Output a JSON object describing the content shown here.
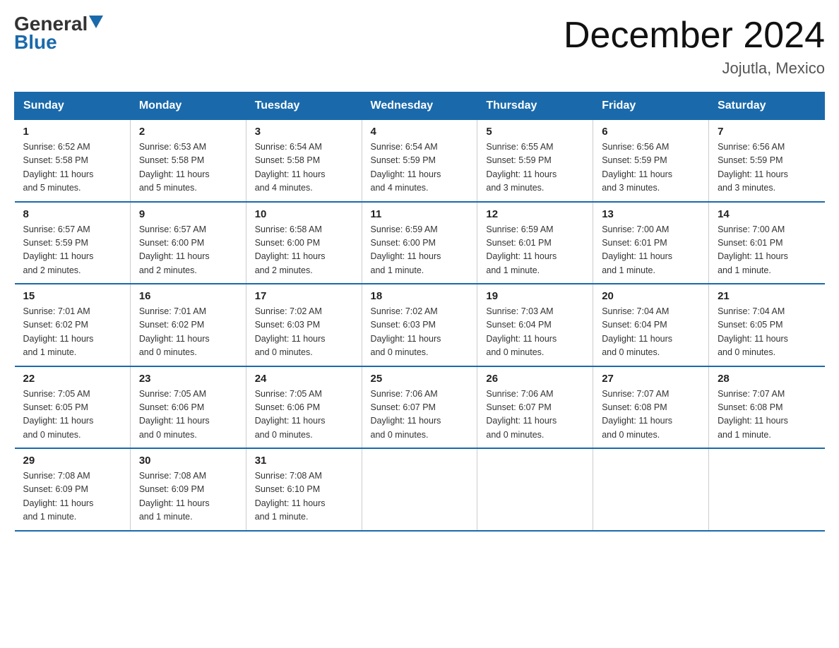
{
  "header": {
    "logo_general": "General",
    "logo_blue": "Blue",
    "title": "December 2024",
    "subtitle": "Jojutla, Mexico"
  },
  "days_of_week": [
    "Sunday",
    "Monday",
    "Tuesday",
    "Wednesday",
    "Thursday",
    "Friday",
    "Saturday"
  ],
  "weeks": [
    [
      {
        "day": "1",
        "sunrise": "6:52 AM",
        "sunset": "5:58 PM",
        "daylight": "11 hours and 5 minutes."
      },
      {
        "day": "2",
        "sunrise": "6:53 AM",
        "sunset": "5:58 PM",
        "daylight": "11 hours and 5 minutes."
      },
      {
        "day": "3",
        "sunrise": "6:54 AM",
        "sunset": "5:58 PM",
        "daylight": "11 hours and 4 minutes."
      },
      {
        "day": "4",
        "sunrise": "6:54 AM",
        "sunset": "5:59 PM",
        "daylight": "11 hours and 4 minutes."
      },
      {
        "day": "5",
        "sunrise": "6:55 AM",
        "sunset": "5:59 PM",
        "daylight": "11 hours and 3 minutes."
      },
      {
        "day": "6",
        "sunrise": "6:56 AM",
        "sunset": "5:59 PM",
        "daylight": "11 hours and 3 minutes."
      },
      {
        "day": "7",
        "sunrise": "6:56 AM",
        "sunset": "5:59 PM",
        "daylight": "11 hours and 3 minutes."
      }
    ],
    [
      {
        "day": "8",
        "sunrise": "6:57 AM",
        "sunset": "5:59 PM",
        "daylight": "11 hours and 2 minutes."
      },
      {
        "day": "9",
        "sunrise": "6:57 AM",
        "sunset": "6:00 PM",
        "daylight": "11 hours and 2 minutes."
      },
      {
        "day": "10",
        "sunrise": "6:58 AM",
        "sunset": "6:00 PM",
        "daylight": "11 hours and 2 minutes."
      },
      {
        "day": "11",
        "sunrise": "6:59 AM",
        "sunset": "6:00 PM",
        "daylight": "11 hours and 1 minute."
      },
      {
        "day": "12",
        "sunrise": "6:59 AM",
        "sunset": "6:01 PM",
        "daylight": "11 hours and 1 minute."
      },
      {
        "day": "13",
        "sunrise": "7:00 AM",
        "sunset": "6:01 PM",
        "daylight": "11 hours and 1 minute."
      },
      {
        "day": "14",
        "sunrise": "7:00 AM",
        "sunset": "6:01 PM",
        "daylight": "11 hours and 1 minute."
      }
    ],
    [
      {
        "day": "15",
        "sunrise": "7:01 AM",
        "sunset": "6:02 PM",
        "daylight": "11 hours and 1 minute."
      },
      {
        "day": "16",
        "sunrise": "7:01 AM",
        "sunset": "6:02 PM",
        "daylight": "11 hours and 0 minutes."
      },
      {
        "day": "17",
        "sunrise": "7:02 AM",
        "sunset": "6:03 PM",
        "daylight": "11 hours and 0 minutes."
      },
      {
        "day": "18",
        "sunrise": "7:02 AM",
        "sunset": "6:03 PM",
        "daylight": "11 hours and 0 minutes."
      },
      {
        "day": "19",
        "sunrise": "7:03 AM",
        "sunset": "6:04 PM",
        "daylight": "11 hours and 0 minutes."
      },
      {
        "day": "20",
        "sunrise": "7:04 AM",
        "sunset": "6:04 PM",
        "daylight": "11 hours and 0 minutes."
      },
      {
        "day": "21",
        "sunrise": "7:04 AM",
        "sunset": "6:05 PM",
        "daylight": "11 hours and 0 minutes."
      }
    ],
    [
      {
        "day": "22",
        "sunrise": "7:05 AM",
        "sunset": "6:05 PM",
        "daylight": "11 hours and 0 minutes."
      },
      {
        "day": "23",
        "sunrise": "7:05 AM",
        "sunset": "6:06 PM",
        "daylight": "11 hours and 0 minutes."
      },
      {
        "day": "24",
        "sunrise": "7:05 AM",
        "sunset": "6:06 PM",
        "daylight": "11 hours and 0 minutes."
      },
      {
        "day": "25",
        "sunrise": "7:06 AM",
        "sunset": "6:07 PM",
        "daylight": "11 hours and 0 minutes."
      },
      {
        "day": "26",
        "sunrise": "7:06 AM",
        "sunset": "6:07 PM",
        "daylight": "11 hours and 0 minutes."
      },
      {
        "day": "27",
        "sunrise": "7:07 AM",
        "sunset": "6:08 PM",
        "daylight": "11 hours and 0 minutes."
      },
      {
        "day": "28",
        "sunrise": "7:07 AM",
        "sunset": "6:08 PM",
        "daylight": "11 hours and 1 minute."
      }
    ],
    [
      {
        "day": "29",
        "sunrise": "7:08 AM",
        "sunset": "6:09 PM",
        "daylight": "11 hours and 1 minute."
      },
      {
        "day": "30",
        "sunrise": "7:08 AM",
        "sunset": "6:09 PM",
        "daylight": "11 hours and 1 minute."
      },
      {
        "day": "31",
        "sunrise": "7:08 AM",
        "sunset": "6:10 PM",
        "daylight": "11 hours and 1 minute."
      },
      null,
      null,
      null,
      null
    ]
  ]
}
